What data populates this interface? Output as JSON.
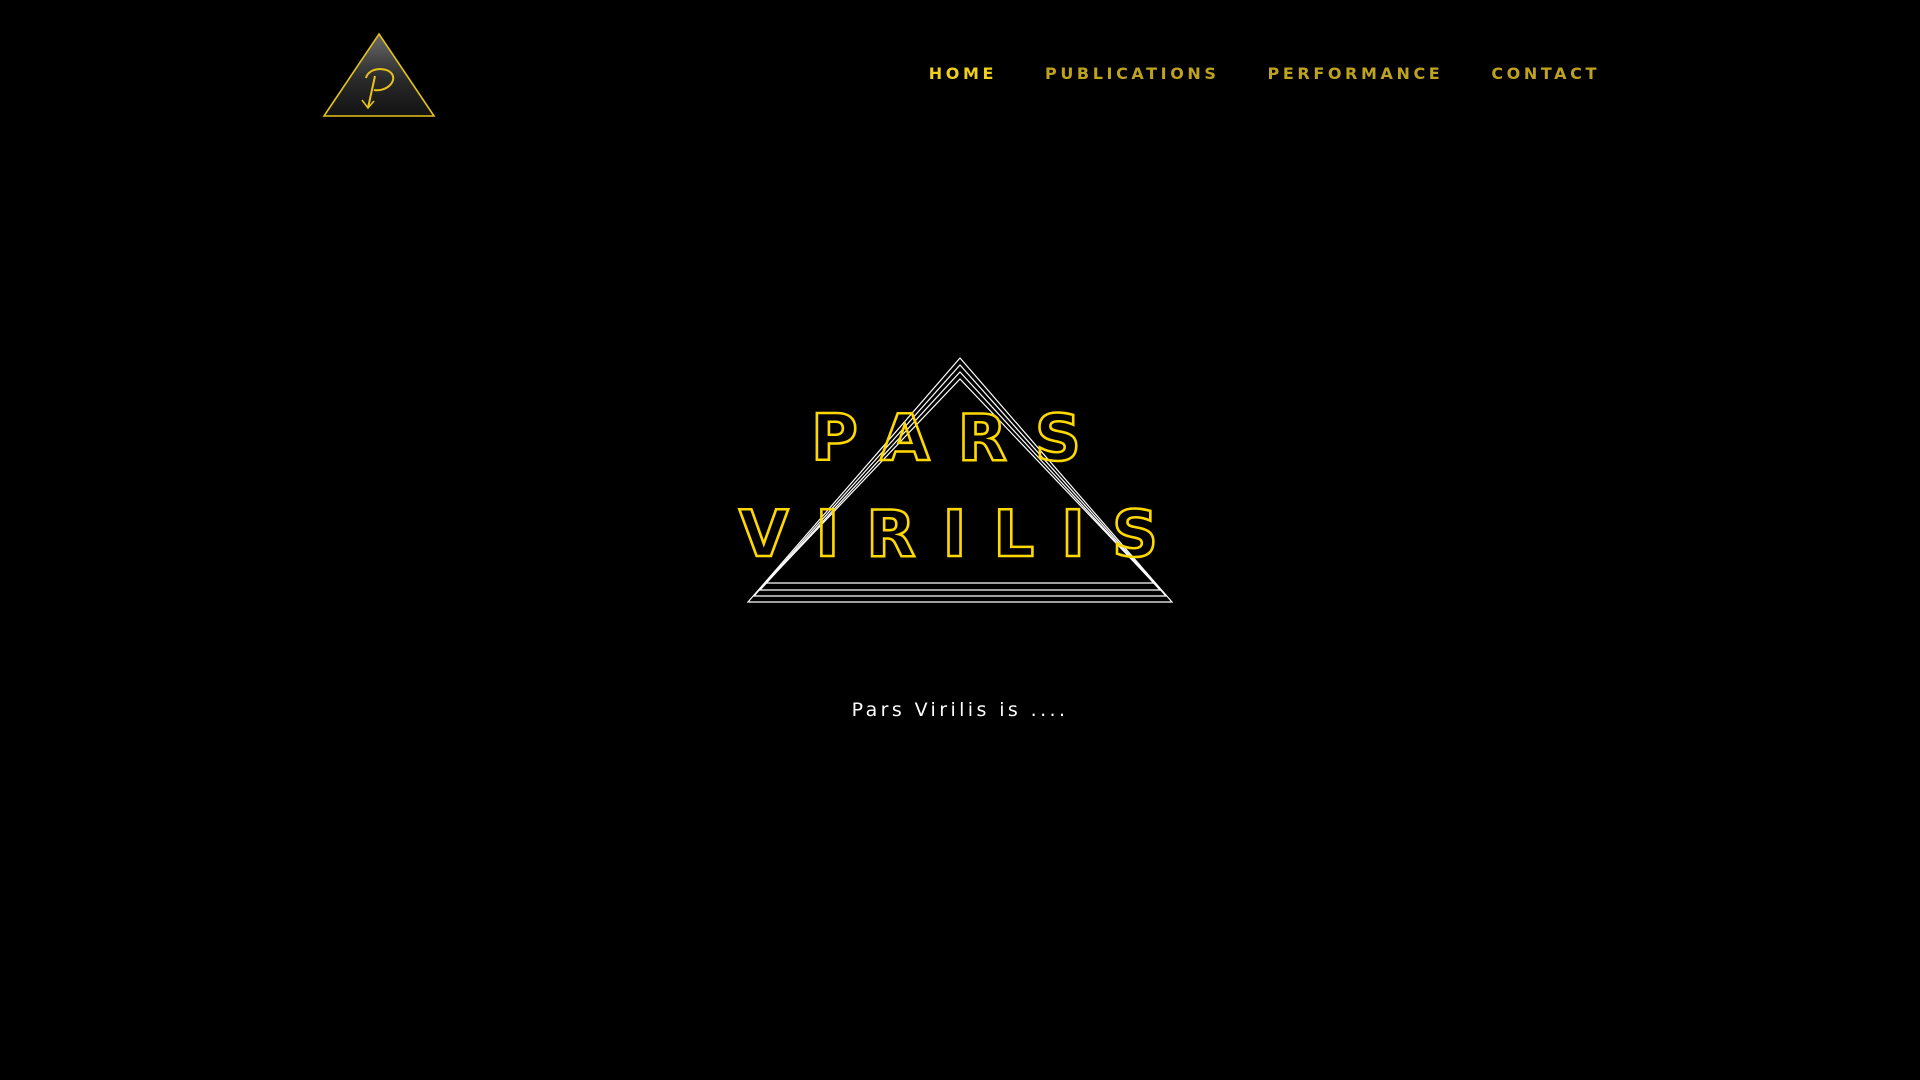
{
  "header": {
    "logo_icon": "triangle-p-logo-icon",
    "nav": [
      {
        "label": "HOME",
        "active": true
      },
      {
        "label": "PUBLICATIONS",
        "active": false
      },
      {
        "label": "PERFORMANCE",
        "active": false
      },
      {
        "label": "CONTACT",
        "active": false
      }
    ]
  },
  "hero": {
    "title_line1": "PARS",
    "title_line2": "VIRILIS",
    "graphic_icon": "nested-triangles-icon",
    "tagline": "Pars Virilis is ...."
  },
  "colors": {
    "background": "#000000",
    "accent": "#f2cf19",
    "nav_inactive": "#bfa21f",
    "title_outline": "#ffd800",
    "triangle_lines": "#ffffff",
    "tagline": "#ffffff"
  }
}
